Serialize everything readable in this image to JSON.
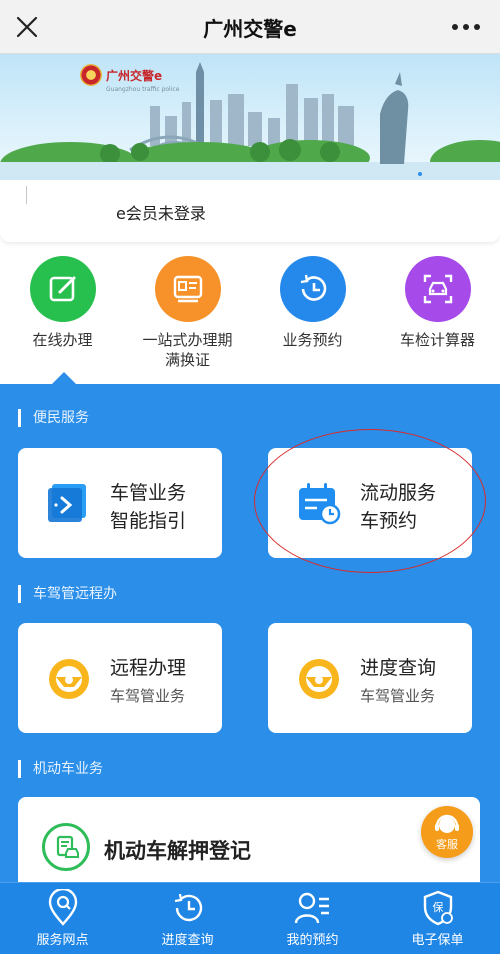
{
  "app": {
    "title": "广州交警e"
  },
  "banner": {
    "logo_text": "广州交警e",
    "logo_sub": "Guangzhou traffic police"
  },
  "member": {
    "label": "e会员未登录"
  },
  "quick_actions": [
    {
      "label": "在线办理",
      "icon": "edit-icon",
      "color": "#27c04f"
    },
    {
      "label": "一站式办理期满换证",
      "icon": "id-card-icon",
      "color": "#f7922b"
    },
    {
      "label": "业务预约",
      "icon": "history-icon",
      "color": "#2589ec"
    },
    {
      "label": "车检计算器",
      "icon": "car-scan-icon",
      "color": "#a64bea"
    }
  ],
  "sections": {
    "convenience": {
      "title": "便民服务",
      "cards": [
        {
          "line1": "车管业务",
          "line2": "智能指引",
          "icon": "guide-icon"
        },
        {
          "line1": "流动服务",
          "line2": "车预约",
          "icon": "calendar-clock-icon"
        }
      ]
    },
    "remote": {
      "title": "车驾管远程办",
      "cards": [
        {
          "line1": "远程办理",
          "line2": "车驾管业务",
          "icon": "steering-wheel-icon"
        },
        {
          "line1": "进度查询",
          "line2": "车驾管业务",
          "icon": "steering-wheel-icon"
        }
      ]
    },
    "vehicle": {
      "title": "机动车业务",
      "cards": [
        {
          "label": "机动车解押登记",
          "icon": "vehicle-doc-icon"
        }
      ]
    }
  },
  "customer_service": {
    "label": "客服"
  },
  "bottom_nav": [
    {
      "label": "服务网点",
      "icon": "location-icon"
    },
    {
      "label": "进度查询",
      "icon": "history-icon"
    },
    {
      "label": "我的预约",
      "icon": "user-list-icon"
    },
    {
      "label": "电子保单",
      "icon": "shield-icon"
    }
  ],
  "colors": {
    "brand_blue": "#2b8fea",
    "nav_blue": "#1f86e6",
    "annotation_red": "#d72b2b",
    "kefu_orange": "#f59c1a"
  }
}
